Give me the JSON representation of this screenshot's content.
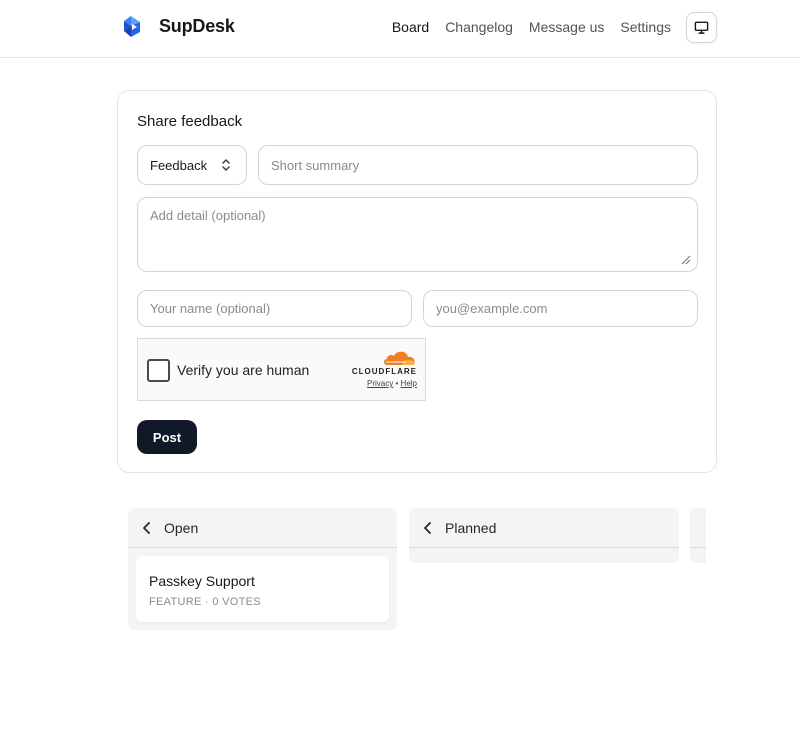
{
  "header": {
    "brand": "SupDesk",
    "nav": [
      {
        "label": "Board",
        "active": true
      },
      {
        "label": "Changelog",
        "active": false
      },
      {
        "label": "Message us",
        "active": false
      },
      {
        "label": "Settings",
        "active": false
      }
    ],
    "theme_icon": "monitor-icon"
  },
  "form": {
    "title": "Share feedback",
    "type_select": {
      "value": "Feedback",
      "icon": "chevron-up-down-icon"
    },
    "summary": {
      "value": "",
      "placeholder": "Short summary"
    },
    "detail": {
      "value": "",
      "placeholder": "Add detail (optional)"
    },
    "name": {
      "value": "",
      "placeholder": "Your name (optional)"
    },
    "email": {
      "value": "",
      "placeholder": "you@example.com"
    },
    "captcha": {
      "label": "Verify you are human",
      "brand": "CLOUDFLARE",
      "privacy": "Privacy",
      "separator": "•",
      "help": "Help",
      "accent": "#f38020"
    },
    "submit_label": "Post"
  },
  "board": {
    "columns": [
      {
        "title": "Open",
        "items": [
          {
            "title": "Passkey Support",
            "type": "FEATURE",
            "separator": "·",
            "votes": "0 VOTES"
          }
        ]
      },
      {
        "title": "Planned",
        "items": []
      }
    ]
  },
  "colors": {
    "primary_button": "#111827",
    "logo_blue": "#2563eb",
    "border": "#d4d4d8",
    "column_bg": "#f4f4f5"
  }
}
